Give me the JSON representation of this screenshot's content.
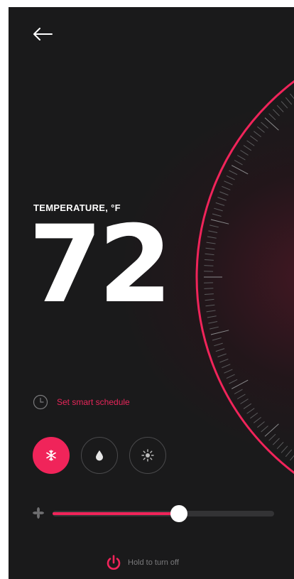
{
  "colors": {
    "background": "#1a1a1b",
    "accent": "#f0245a",
    "text": "#ffffff",
    "muted": "#7a7a7c"
  },
  "header": {
    "back_icon": "arrow-left-icon"
  },
  "temperature": {
    "label": "TEMPERATURE, °F",
    "value": "72"
  },
  "dial": {
    "icon": "temperature-dial"
  },
  "schedule": {
    "icon": "clock-icon",
    "label": "Set smart schedule"
  },
  "modes": [
    {
      "icon": "snowflake-icon",
      "active": true
    },
    {
      "icon": "droplet-icon",
      "active": false
    },
    {
      "icon": "sun-icon",
      "active": false
    }
  ],
  "fan": {
    "icon": "fan-icon",
    "level": 0.57
  },
  "power": {
    "icon": "power-icon",
    "label": "Hold to turn off"
  }
}
